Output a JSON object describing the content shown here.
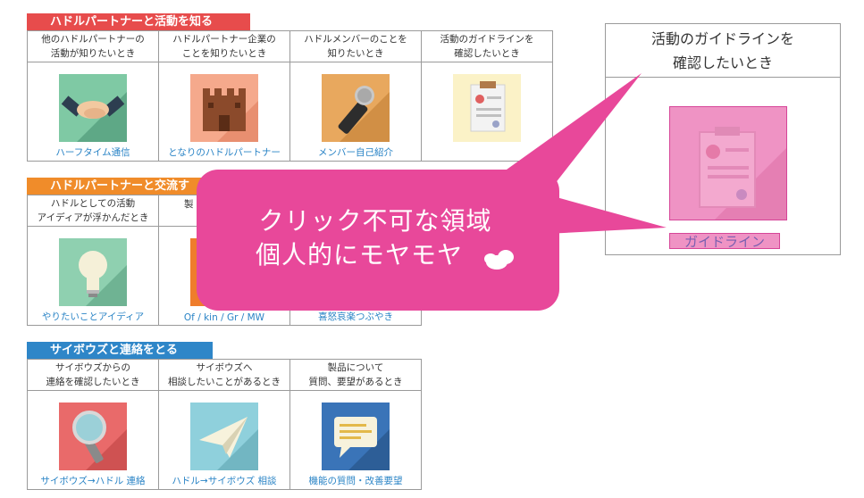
{
  "colors": {
    "section1": "#e74c4c",
    "section2": "#f08c2a",
    "section3": "#2e86c8",
    "bubble": "#e8489a",
    "link": "#2a84c6"
  },
  "section1": {
    "heading": "ハドルパートナーと活動を知る",
    "cells": [
      {
        "desc1": "他のハドルパートナーの",
        "desc2": "活動が知りたいとき",
        "icon": "handshake-icon",
        "link": "ハーフタイム通信"
      },
      {
        "desc1": "ハドルパートナー企業の",
        "desc2": "ことを知りたいとき",
        "icon": "castle-icon",
        "link": "となりのハドルパートナー"
      },
      {
        "desc1": "ハドルメンバーのことを",
        "desc2": "知りたいとき",
        "icon": "microphone-icon",
        "link": "メンバー自己紹介"
      },
      {
        "desc1": "活動のガイドラインを",
        "desc2": "確認したいとき",
        "icon": "clipboard-certificate-icon",
        "link": ""
      }
    ]
  },
  "section2": {
    "heading": "ハドルパートナーと交流す",
    "cells": [
      {
        "desc1": "ハドルとしての活動",
        "desc2": "アイディアが浮かんだとき",
        "icon": "lightbulb-icon",
        "link": "やりたいことアイディア"
      },
      {
        "desc1": "製",
        "desc2": "",
        "icon": "orange-tile-icon",
        "link": "Of / kin / Gr / MW"
      },
      {
        "desc1": "",
        "desc2": "",
        "icon": "",
        "link": "喜怒哀楽つぶやき"
      }
    ]
  },
  "section3": {
    "heading": "サイボウズと連絡をとる",
    "cells": [
      {
        "desc1": "サイボウズからの",
        "desc2": "連絡を確認したいとき",
        "icon": "magnifier-icon",
        "link": "サイボウズ→ハドル 連絡"
      },
      {
        "desc1": "サイボウズへ",
        "desc2": "相談したいことがあるとき",
        "icon": "paper-plane-icon",
        "link": "ハドル→サイボウズ 相談"
      },
      {
        "desc1": "製品について",
        "desc2": "質問、要望があるとき",
        "icon": "speech-bubble-icon",
        "link": "機能の質問・改善要望"
      }
    ]
  },
  "zoom": {
    "desc1": "活動のガイドラインを",
    "desc2": "確認したいとき",
    "link": "ガイドライン"
  },
  "bubble": {
    "line1": "クリック不可な領域",
    "line2": "個人的にモヤモヤ"
  }
}
